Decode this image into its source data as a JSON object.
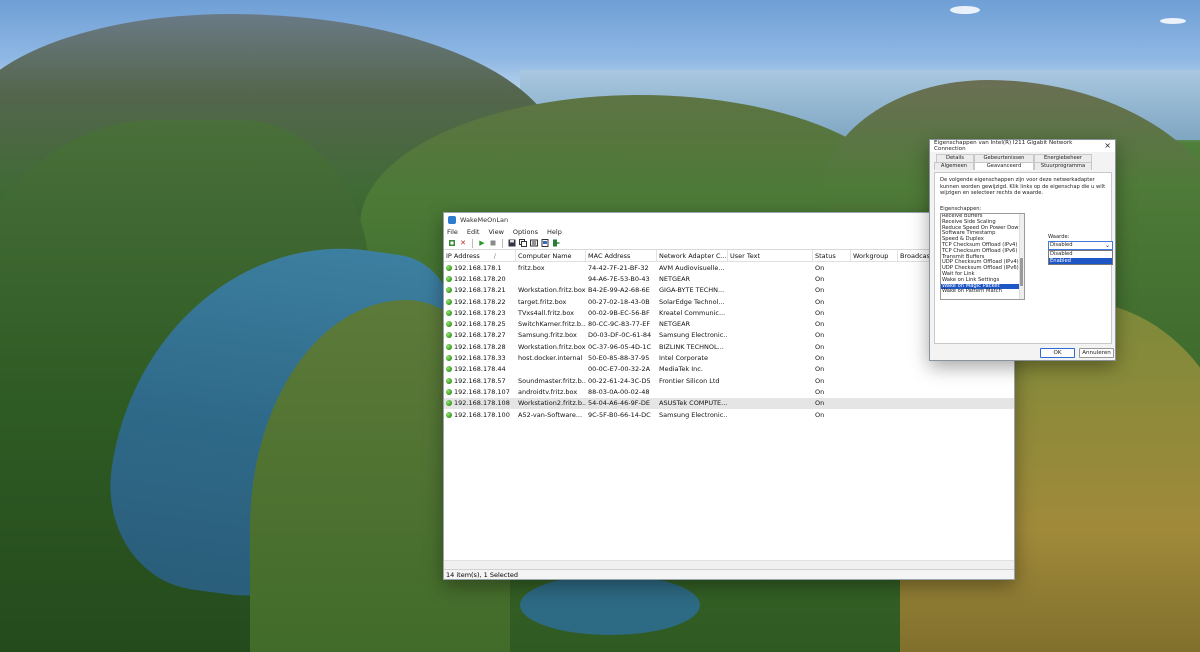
{
  "wallpaper": {
    "description_icon": "mountain-landscape-wallpaper"
  },
  "app": {
    "title": "WakeMeOnLan",
    "menu": [
      "File",
      "Edit",
      "View",
      "Options",
      "Help"
    ],
    "columns": [
      "IP Address",
      "Computer Name",
      "MAC Address",
      "Network Adapter C...",
      "User Text",
      "Status",
      "Workgroup",
      "Broadcast"
    ],
    "rows": [
      {
        "ip": "192.168.178.1",
        "name": "fritz.box",
        "mac": "74-42-7F-21-BF-32",
        "vendor": "AVM Audiovisuelle...",
        "status": "On"
      },
      {
        "ip": "192.168.178.20",
        "name": "",
        "mac": "94-A6-7E-53-B0-43",
        "vendor": "NETGEAR",
        "status": "On"
      },
      {
        "ip": "192.168.178.21",
        "name": "Workstation.fritz.box",
        "mac": "B4-2E-99-A2-68-6E",
        "vendor": "GIGA-BYTE TECHN...",
        "status": "On"
      },
      {
        "ip": "192.168.178.22",
        "name": "target.fritz.box",
        "mac": "00-27-02-18-43-0B",
        "vendor": "SolarEdge Technol...",
        "status": "On"
      },
      {
        "ip": "192.168.178.23",
        "name": "TVxs4all.fritz.box",
        "mac": "00-02-9B-EC-56-BF",
        "vendor": "Kreatel Communic...",
        "status": "On"
      },
      {
        "ip": "192.168.178.25",
        "name": "SwitchKamer.fritz.b...",
        "mac": "80-CC-9C-83-77-EF",
        "vendor": "NETGEAR",
        "status": "On"
      },
      {
        "ip": "192.168.178.27",
        "name": "Samsung.fritz.box",
        "mac": "D0-03-DF-0C-61-84",
        "vendor": "Samsung Electronic...",
        "status": "On"
      },
      {
        "ip": "192.168.178.28",
        "name": "Workstation.fritz.box",
        "mac": "0C-37-96-05-4D-1C",
        "vendor": "BIZLINK TECHNOL...",
        "status": "On"
      },
      {
        "ip": "192.168.178.33",
        "name": "host.docker.internal",
        "mac": "50-E0-85-88-37-95",
        "vendor": "Intel Corporate",
        "status": "On"
      },
      {
        "ip": "192.168.178.44",
        "name": "",
        "mac": "00-0C-E7-00-32-2A",
        "vendor": "MediaTek Inc.",
        "status": "On"
      },
      {
        "ip": "192.168.178.57",
        "name": "Soundmaster.fritz.b...",
        "mac": "00-22-61-24-3C-D5",
        "vendor": "Frontier Silicon Ltd",
        "status": "On"
      },
      {
        "ip": "192.168.178.107",
        "name": "androidtv.fritz.box",
        "mac": "88-03-0A-00-02-48",
        "vendor": "",
        "status": "On"
      },
      {
        "ip": "192.168.178.108",
        "name": "Workstation2.fritz.b...",
        "mac": "54-04-A6-46-9F-DE",
        "vendor": "ASUSTek COMPUTE...",
        "status": "On"
      },
      {
        "ip": "192.168.178.100",
        "name": "A52-van-Software...",
        "mac": "9C-5F-B0-66-14-DC",
        "vendor": "Samsung Electronic...",
        "status": "On"
      }
    ],
    "selected_row_index": 12,
    "status_bar": "14 item(s), 1 Selected"
  },
  "dialog": {
    "title": "Eigenschappen van Intel(R) I211 Gigabit Network Connection",
    "tabs_row1": [
      "Details",
      "Gebeurtenissen",
      "Energiebeheer"
    ],
    "tabs_row2": [
      "Algemeen",
      "Geavanceerd",
      "Stuurprogramma"
    ],
    "active_tab": "Geavanceerd",
    "description": "De volgende eigenschappen zijn voor deze netwerkadapter kunnen worden gewijzigd. Klik links op de eigenschap die u wilt wijzigen en selecteer rechts de waarde.",
    "props_label": "Eigenschappen:",
    "value_label": "Waarde:",
    "properties": [
      "Receive Buffers",
      "Receive Side Scaling",
      "Reduce Speed On Power Down",
      "Software Timestamp",
      "Speed & Duplex",
      "TCP Checksum Offload (IPv4)",
      "TCP Checksum Offload (IPv6)",
      "Transmit Buffers",
      "UDP Checksum Offload (IPv4)",
      "UDP Checksum Offload (IPv6)",
      "Wait for Link",
      "Wake on Link Settings",
      "Wake on Magic Packet",
      "Wake on Pattern Match"
    ],
    "selected_property": "Wake on Magic Packet",
    "value_current": "Disabled",
    "value_options": [
      "Disabled",
      "Enabled"
    ],
    "value_highlighted": "Enabled",
    "ok_label": "OK",
    "cancel_label": "Annuleren"
  }
}
